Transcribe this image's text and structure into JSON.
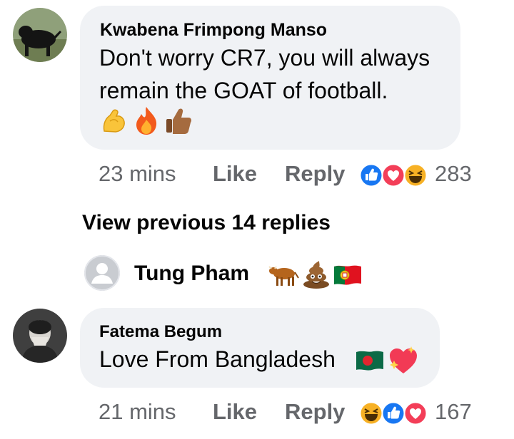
{
  "comments": [
    {
      "author": "Kwabena Frimpong Manso",
      "text_lines": [
        "Don't worry CR7, you will always",
        "remain the GOAT of football."
      ],
      "emoji_line": [
        "flexed-biceps-icon",
        "fire-icon",
        "thumbs-up-icon"
      ],
      "time": "23 mins",
      "like_label": "Like",
      "reply_label": "Reply",
      "reactions": [
        "like-reaction-icon",
        "love-reaction-icon",
        "haha-reaction-icon"
      ],
      "reaction_count": "283"
    },
    {
      "author": "Fatema Begum",
      "text": "Love  From Bangladesh",
      "emoji_after": [
        "bangladesh-flag-icon",
        "sparkling-heart-icon"
      ],
      "time": "21 mins",
      "like_label": "Like",
      "reply_label": "Reply",
      "reactions": [
        "haha-reaction-icon",
        "like-reaction-icon",
        "love-reaction-icon"
      ],
      "reaction_count": "167"
    }
  ],
  "view_previous": "View previous 14 replies",
  "reply_preview": {
    "author": "Tung Pham",
    "emojis": [
      "ox-icon",
      "pile-of-poo-icon",
      "portugal-flag-icon"
    ]
  },
  "colors": {
    "bubble": "#f0f2f5",
    "meta_text": "#65676b",
    "like_blue": "#1877f2",
    "love_red": "#f33e58",
    "haha_yellow": "#f7b125"
  }
}
